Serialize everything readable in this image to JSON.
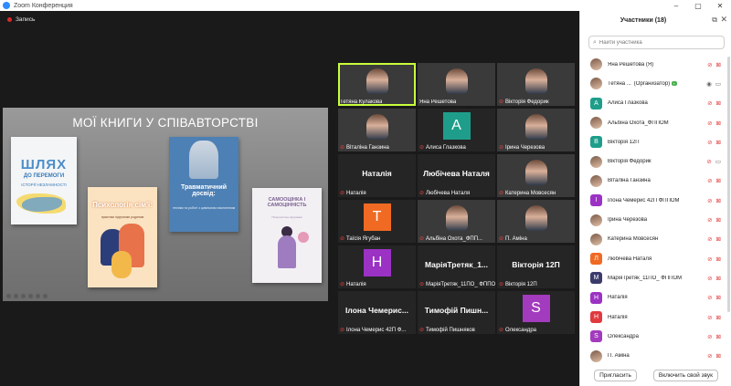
{
  "window": {
    "title": "Zoom Конференция",
    "controls": [
      "–",
      "▢",
      "✕"
    ]
  },
  "recording": {
    "label": "Запись"
  },
  "shared_screen": {
    "slide_title": "МОЇ КНИГИ У СПІВАВТОРСТВІ",
    "books": [
      {
        "title": "ШЛЯХ",
        "subtitle": "ДО ПЕРЕМОГИ",
        "tagline": "ІСТОРІЇ НЕЗЛАМНОСТІ"
      },
      {
        "title": "Психологія сім'ї:",
        "subtitle": "практики підтримки родинам"
      },
      {
        "title": "Травматичний досвід:",
        "subtitle": "технікм та роботі з цивільним населенням"
      },
      {
        "title": "САМООЦІНКА І САМОЦІННІСТЬ",
        "subtitle": "Психологічна підтримка"
      }
    ]
  },
  "video_tiles": [
    {
      "name": "Тетяна Кулакова",
      "type": "photo",
      "active": true,
      "muted": false
    },
    {
      "name": "Яна Решетова",
      "type": "photo",
      "muted": false
    },
    {
      "name": "Вікторія Федорик",
      "type": "photo",
      "muted": true
    },
    {
      "name": "Віталіна Ганзина",
      "type": "photo",
      "muted": true
    },
    {
      "name": "Алиса Глазкова",
      "type": "avatar",
      "initial": "А",
      "color": "#1e9e8a",
      "muted": true
    },
    {
      "name": "Ірина Черезова",
      "type": "photo",
      "muted": true
    },
    {
      "name": "Наталія",
      "type": "text",
      "big": "Наталія",
      "muted": true
    },
    {
      "name": "Любічева Наталя",
      "type": "text",
      "big": "Любічева Наталя",
      "muted": true
    },
    {
      "name": "Катерина Мовсесян",
      "type": "photo",
      "muted": true
    },
    {
      "name": "Таїсія Ягубан",
      "type": "avatar",
      "initial": "Т",
      "color": "#f06a23",
      "muted": true
    },
    {
      "name": "Альбіна Охота_ФПП...",
      "type": "photo",
      "muted": true
    },
    {
      "name": "П. Аміна",
      "type": "photo",
      "muted": true
    },
    {
      "name": "Наталія",
      "type": "avatar",
      "initial": "Н",
      "color": "#9b32c4",
      "muted": true
    },
    {
      "name": "МаріяТретяк_11ПО_ ФППОМ",
      "type": "text",
      "big": "МаріяТретяк_1...",
      "muted": true
    },
    {
      "name": "Вікторія 12П",
      "type": "text",
      "big": "Вікторія 12П",
      "muted": true
    },
    {
      "name": "Ілона Чемерис 42П Ф...",
      "type": "text",
      "big": "Ілона Чемерис...",
      "muted": true
    },
    {
      "name": "Тимофій Пишняков",
      "type": "text",
      "big": "Тимофій Пишн...",
      "muted": true
    },
    {
      "name": "Олександра",
      "type": "avatar",
      "initial": "S",
      "color": "#a23bbd",
      "muted": true
    }
  ],
  "participants_panel": {
    "title": "Участники (18)",
    "search_placeholder": "Найти участника",
    "participants": [
      {
        "name": "Яна Решетова (Я)",
        "avatar": "photo",
        "video_off": true,
        "muted": true
      },
      {
        "name": "Тетяна ...",
        "role": "(Организатор)",
        "avatar": "photo",
        "video_off": false,
        "muted": false
      },
      {
        "name": "Алиса Глазкова",
        "avatar": "А",
        "color": "#1e9e8a",
        "video_off": true,
        "muted": true
      },
      {
        "name": "Альбіна Охота_ФППОМ",
        "avatar": "photo",
        "video_off": true,
        "muted": true
      },
      {
        "name": "Вікторія 12П",
        "avatar": "В",
        "color": "#1e9e8a",
        "video_off": true,
        "muted": true
      },
      {
        "name": "Вікторія Федорик",
        "avatar": "photo",
        "video_off": false,
        "muted": true
      },
      {
        "name": "Віталіна Ганзина",
        "avatar": "photo",
        "video_off": true,
        "muted": true
      },
      {
        "name": "Ілона Чемерис 42П ФППОМ",
        "avatar": "І",
        "color": "#9b32c4",
        "video_off": true,
        "muted": true
      },
      {
        "name": "Ірина Черезова",
        "avatar": "photo",
        "video_off": true,
        "muted": true
      },
      {
        "name": "Катерина Мовсесян",
        "avatar": "photo",
        "video_off": true,
        "muted": true
      },
      {
        "name": "Любічева Наталя",
        "avatar": "Л",
        "color": "#f06a23",
        "video_off": true,
        "muted": true
      },
      {
        "name": "МаріяТретяк_11ПО_ ФППОМ",
        "avatar": "М",
        "color": "#3b3b6b",
        "video_off": true,
        "muted": true
      },
      {
        "name": "Наталія",
        "avatar": "Н",
        "color": "#9b32c4",
        "video_off": true,
        "muted": true
      },
      {
        "name": "Наталія",
        "avatar": "Н",
        "color": "#e0393e",
        "video_off": true,
        "muted": true
      },
      {
        "name": "Олександра",
        "avatar": "S",
        "color": "#a23bbd",
        "video_off": true,
        "muted": true
      },
      {
        "name": "П. Аміна",
        "avatar": "photo",
        "video_off": true,
        "muted": true
      }
    ],
    "invite_label": "Пригласить",
    "unmute_label": "Включить свой звук"
  }
}
